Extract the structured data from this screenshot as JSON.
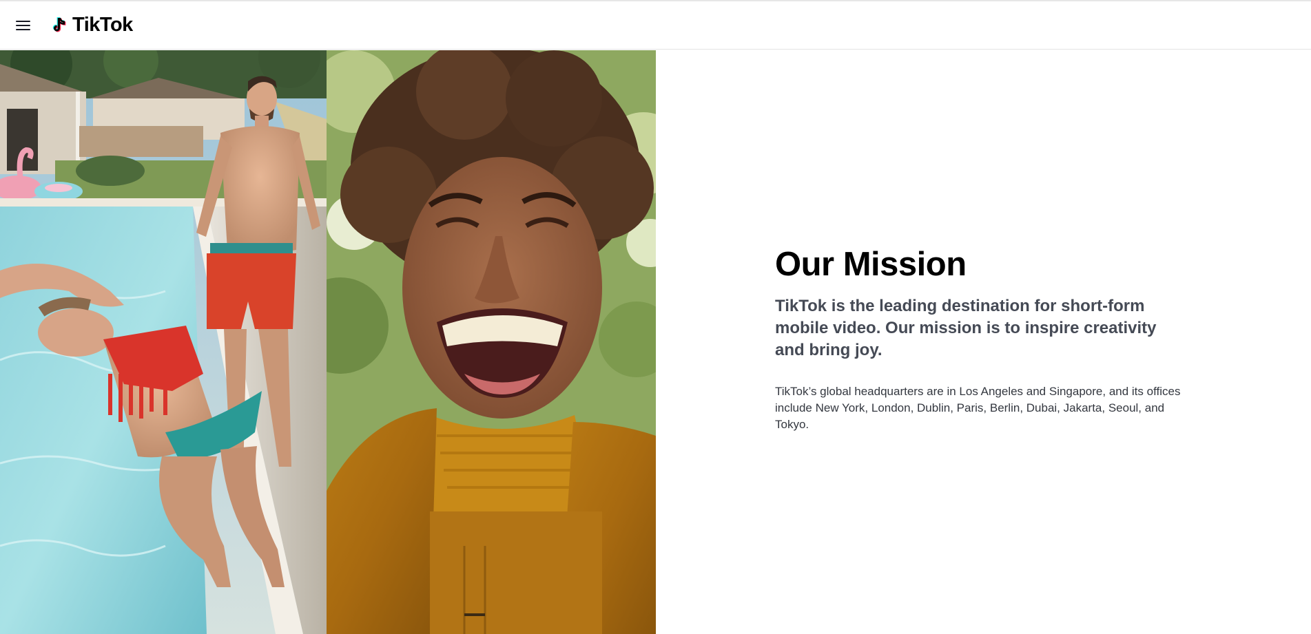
{
  "header": {
    "logo_text": "TikTok",
    "menu_icon": "hamburger-menu-icon"
  },
  "hero": {
    "left_photo": "people jumping into a backyard pool",
    "right_photo": "person laughing in a mustard turtleneck"
  },
  "mission": {
    "title": "Our Mission",
    "lead": "TikTok is the leading destination for short-form mobile video. Our mission is to inspire creativity and bring joy.",
    "body": "TikTok’s global headquarters are in Los Angeles and Singapore, and its offices include New York, London, Dublin, Paris, Berlin, Dubai, Jakarta, Seoul, and Tokyo."
  },
  "colors": {
    "brand_cyan": "#25F4EE",
    "brand_red": "#FE2C55",
    "text_dark": "#000000",
    "text_gray": "#454a55"
  }
}
